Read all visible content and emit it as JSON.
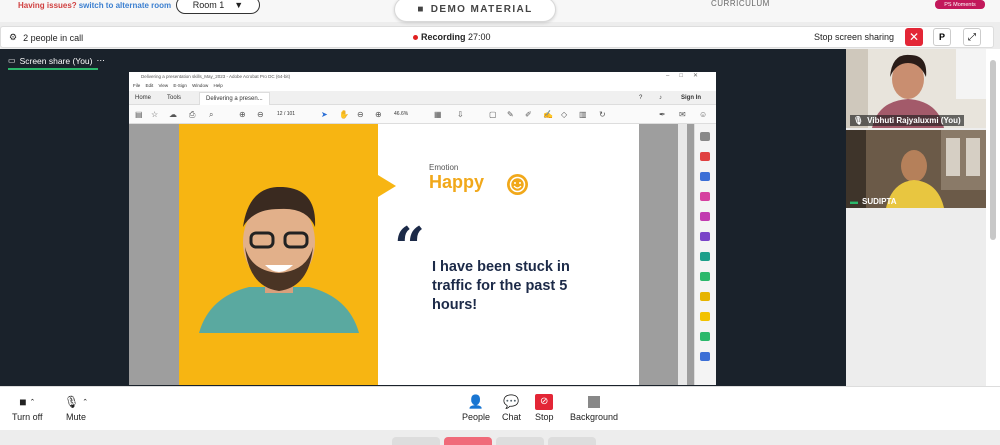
{
  "top": {
    "issues_text": "Having issues?",
    "alt_room_link": "switch to alternate room",
    "room_label": "Room 1",
    "demo_label": "DEMO MATERIAL",
    "curriculum_label": "CURRICULUM",
    "ps_moments": "PS Moments"
  },
  "call": {
    "people_count": "2 people in call",
    "recording_label": "Recording",
    "recording_time": "27:00",
    "stop_sharing": "Stop screen sharing",
    "p_button": "P"
  },
  "share": {
    "label": "Screen share (You)",
    "window_title": "Delivering a presentation skills_May_2023 - Adobe Acrobat Pro DC (64-bit)",
    "menu": "File  Edit  View  E-Sign  Window  Help",
    "tabs": [
      "Home",
      "Tools",
      "Delivering a presen..."
    ],
    "sign_in": "Sign In",
    "page_num": "12  /  101",
    "zoom": "46.6%",
    "slide": {
      "emotion_label": "Emotion",
      "emotion_value": "Happy",
      "quote": "I have been stuck in traffic for the past 5 hours!"
    }
  },
  "participants": [
    {
      "name": "Vibhuti Rajyaluxmi (You)"
    },
    {
      "name": "SUDIPTA"
    }
  ],
  "controls": {
    "turn_off": "Turn off",
    "mute": "Mute",
    "people": "People",
    "chat": "Chat",
    "stop": "Stop",
    "background": "Background"
  },
  "colors": {
    "accent_red": "#e32636",
    "slide_yellow": "#f7b512",
    "quote_navy": "#1c2a48",
    "active_green": "#2bb86b"
  }
}
